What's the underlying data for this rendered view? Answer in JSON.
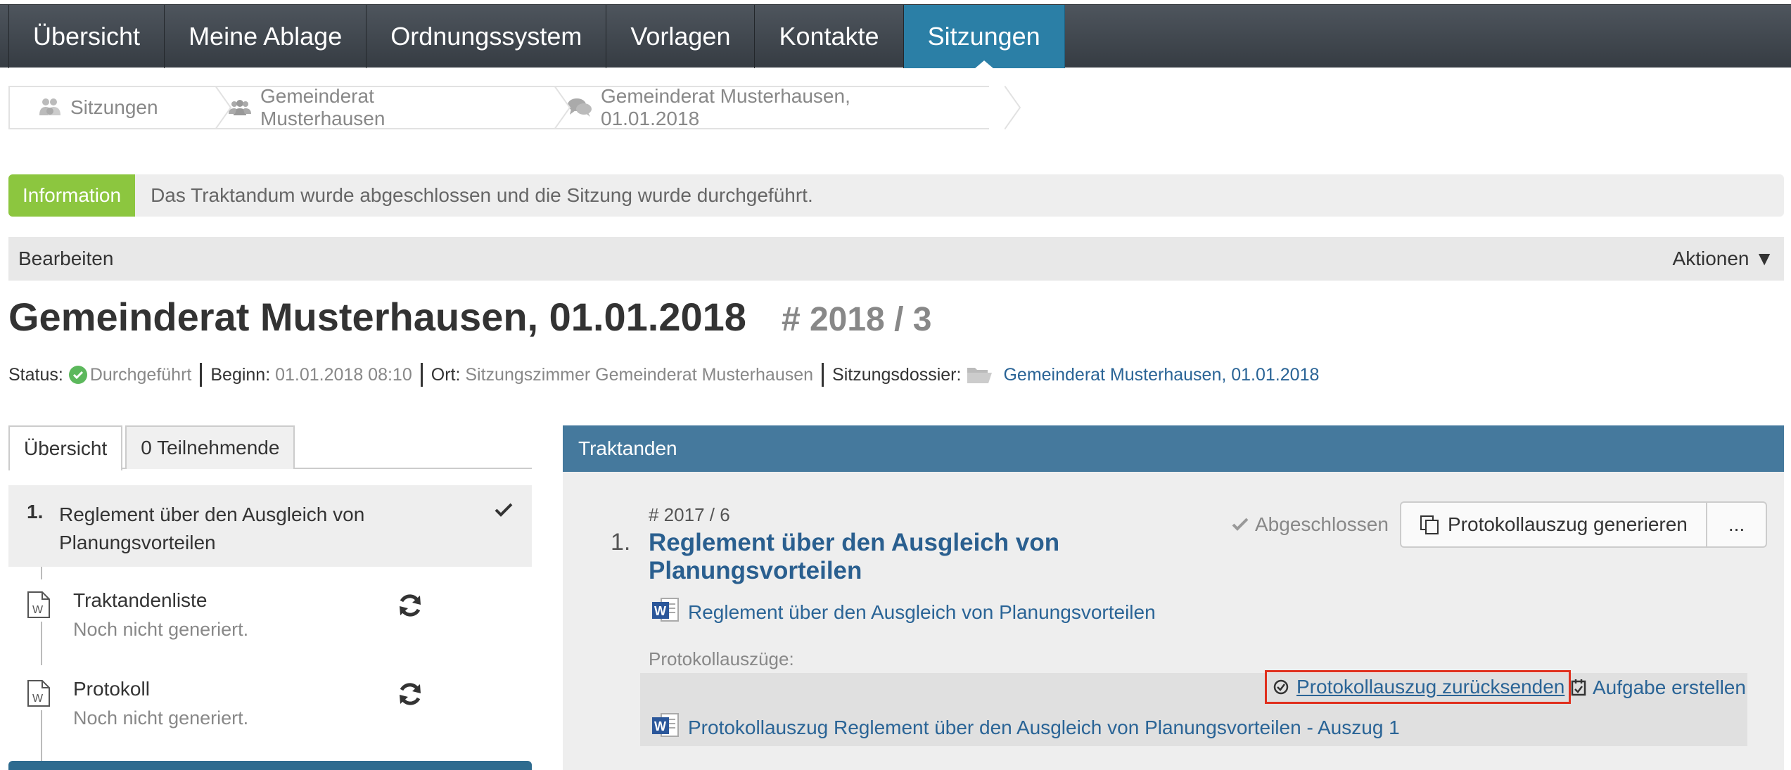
{
  "nav": {
    "items": [
      "Übersicht",
      "Meine Ablage",
      "Ordnungssystem",
      "Vorlagen",
      "Kontakte",
      "Sitzungen"
    ],
    "active_index": 5
  },
  "breadcrumb": {
    "items": [
      "Sitzungen",
      "Gemeinderat Musterhausen",
      "Gemeinderat Musterhausen, 01.01.2018"
    ]
  },
  "info": {
    "label": "Information",
    "text": "Das Traktandum wurde abgeschlossen und die Sitzung wurde durchgeführt."
  },
  "editbar": {
    "edit_label": "Bearbeiten",
    "actions_label": "Aktionen ▼"
  },
  "meeting": {
    "title": "Gemeinderat Musterhausen, 01.01.2018",
    "number": "# 2018 / 3",
    "status_label": "Status:",
    "status_value": "Durchgeführt",
    "begin_label": "Beginn:",
    "begin_value": "01.01.2018 08:10",
    "place_label": "Ort:",
    "place_value": "Sitzungszimmer Gemeinderat Musterhausen",
    "dossier_label": "Sitzungsdossier:",
    "dossier_value": "Gemeinderat Musterhausen, 01.01.2018"
  },
  "left": {
    "tabs": [
      "Übersicht",
      "0 Teilnehmende"
    ],
    "agenda_item": {
      "number": "1.",
      "title_line1": "Reglement über den Ausgleich von",
      "title_line2": "Planungsvorteilen"
    },
    "documents": [
      {
        "name": "Traktandenliste",
        "status": "Noch nicht generiert."
      },
      {
        "name": "Protokoll",
        "status": "Noch nicht generiert."
      }
    ]
  },
  "right": {
    "header": "Traktanden",
    "item": {
      "number": "# 2017 / 6",
      "index": "1.",
      "title": "Reglement über den Ausgleich von Planungsvorteilen",
      "document": "Reglement über den Ausgleich von Planungsvorteilen",
      "status": "Abgeschlossen",
      "generate_button": "Protokollauszug generieren",
      "more_button": "...",
      "excerpts_label": "Protokollauszüge:",
      "send_back_link": "Protokollauszug zurücksenden",
      "create_task_link": "Aufgabe erstellen",
      "excerpt_document": "Protokollauszug Reglement über den Ausgleich von Planungsvorteilen - Auszug 1"
    }
  },
  "colors": {
    "nav_bg": "#3f464d",
    "nav_active": "#2b7fa6",
    "info_green": "#8cc63f",
    "panel_header": "#45799d",
    "link": "#2a6496",
    "highlight_border": "#e0301e"
  }
}
